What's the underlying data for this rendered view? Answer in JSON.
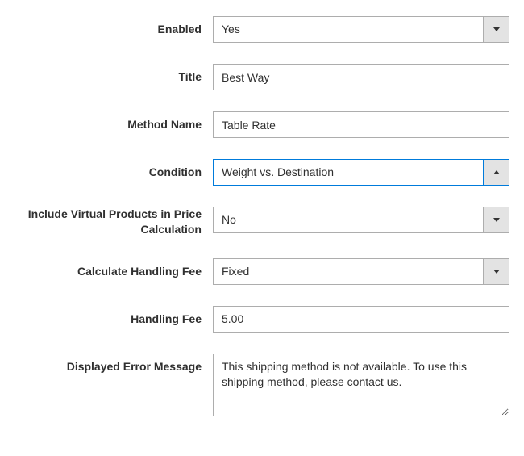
{
  "labels": {
    "enabled": "Enabled",
    "title": "Title",
    "method_name": "Method Name",
    "condition": "Condition",
    "include_virtual": "Include Virtual Products in Price Calculation",
    "calc_handling": "Calculate Handling Fee",
    "handling_fee": "Handling Fee",
    "error_msg": "Displayed Error Message"
  },
  "values": {
    "enabled": "Yes",
    "title": "Best Way",
    "method_name": "Table Rate",
    "condition": "Weight vs. Destination",
    "include_virtual": "No",
    "calc_handling": "Fixed",
    "handling_fee": "5.00",
    "error_msg": "This shipping method is not available. To use this shipping method, please contact us."
  }
}
